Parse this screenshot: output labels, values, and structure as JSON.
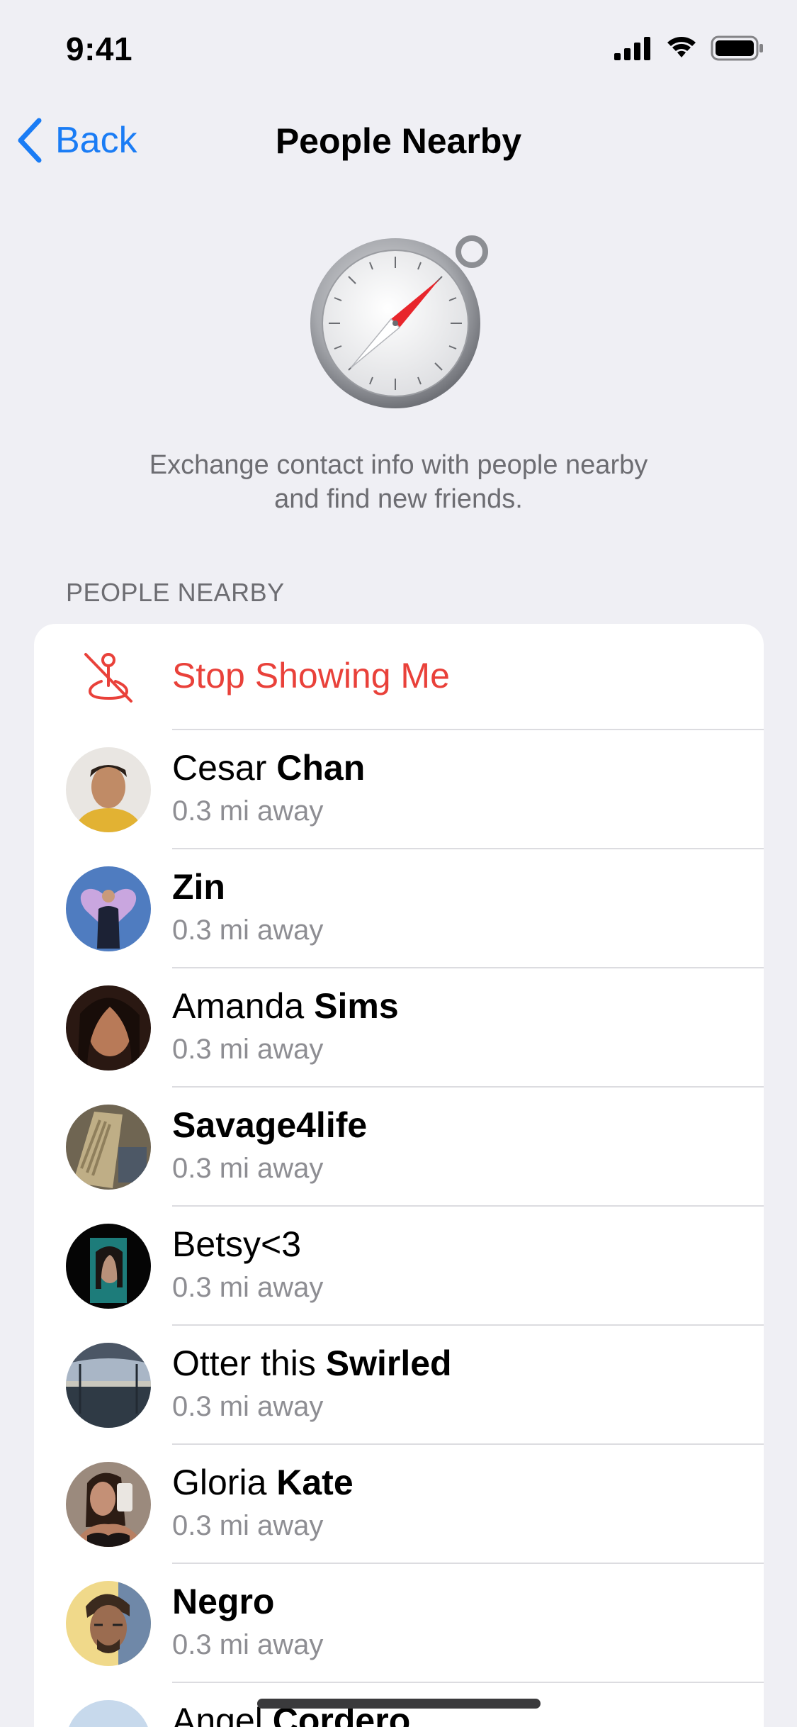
{
  "status_bar": {
    "time": "9:41",
    "icons": [
      "signal-icon",
      "wifi-icon",
      "battery-icon"
    ]
  },
  "nav": {
    "back_label": "Back",
    "title": "People Nearby"
  },
  "hero": {
    "icon": "compass-icon",
    "line1": "Exchange contact info with people nearby",
    "line2": "and find new friends."
  },
  "section_header": "PEOPLE NEARBY",
  "stop_row": {
    "label": "Stop Showing Me",
    "icon": "stop-location-icon",
    "color": "#e9413a"
  },
  "people": [
    {
      "first": "Cesar ",
      "last": "Chan",
      "distance": "0.3 mi away"
    },
    {
      "first": "",
      "last": "Zin",
      "distance": "0.3 mi away"
    },
    {
      "first": "Amanda ",
      "last": "Sims",
      "distance": "0.3 mi away"
    },
    {
      "first": "",
      "last": "Savage4life",
      "distance": "0.3 mi away"
    },
    {
      "first": "Betsy<3",
      "last": "",
      "distance": "0.3 mi away"
    },
    {
      "first": "Otter this ",
      "last": "Swirled",
      "distance": "0.3 mi away"
    },
    {
      "first": "Gloria ",
      "last": "Kate",
      "distance": "0.3 mi away"
    },
    {
      "first": "",
      "last": "Negro",
      "distance": "0.3 mi away"
    },
    {
      "first": "Angel ",
      "last": "Cordero",
      "distance": ""
    }
  ],
  "colors": {
    "accent": "#1a7cf5",
    "destructive": "#e9413a",
    "background": "#efeff4",
    "secondary_text": "#8e8e93"
  }
}
